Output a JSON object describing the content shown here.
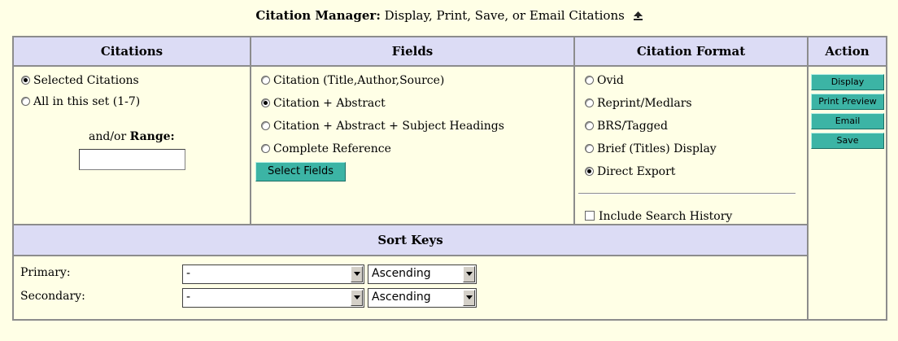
{
  "header": {
    "title_bold": "Citation Manager:",
    "title_rest": " Display, Print, Save, or Email Citations"
  },
  "columns": {
    "citations": "Citations",
    "fields": "Fields",
    "format": "Citation Format",
    "action": "Action"
  },
  "citations": {
    "options": [
      {
        "label": "Selected Citations",
        "checked": true
      },
      {
        "label": "All in this set (1-7)",
        "checked": false
      }
    ],
    "range_prefix": "and/or ",
    "range_label": "Range:",
    "range_value": ""
  },
  "fields": {
    "options": [
      {
        "label": "Citation (Title,Author,Source)",
        "checked": false
      },
      {
        "label": "Citation + Abstract",
        "checked": true
      },
      {
        "label": "Citation + Abstract + Subject Headings",
        "checked": false
      },
      {
        "label": "Complete Reference",
        "checked": false
      }
    ],
    "select_button": "Select Fields"
  },
  "format": {
    "options": [
      {
        "label": "Ovid",
        "checked": false
      },
      {
        "label": "Reprint/Medlars",
        "checked": false
      },
      {
        "label": "BRS/Tagged",
        "checked": false
      },
      {
        "label": "Brief (Titles) Display",
        "checked": false
      },
      {
        "label": "Direct Export",
        "checked": true
      }
    ],
    "history_label": "Include Search History",
    "history_checked": false
  },
  "actions": {
    "display": "Display",
    "print_preview": "Print Preview",
    "email": "Email",
    "save": "Save"
  },
  "sort": {
    "heading": "Sort Keys",
    "primary_label": "Primary:",
    "secondary_label": "Secondary:",
    "primary_field": "-",
    "primary_order": "Ascending",
    "secondary_field": "-",
    "secondary_order": "Ascending"
  },
  "colors": {
    "background": "#ffffe6",
    "header_bg": "#dcdcf5",
    "button_teal": "#3cb4a5"
  }
}
